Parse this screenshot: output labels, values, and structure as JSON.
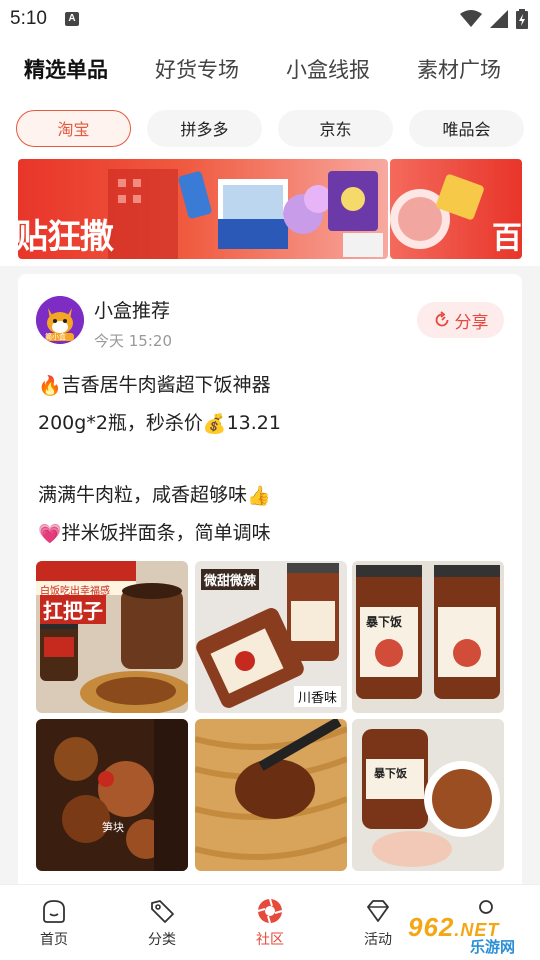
{
  "status_bar": {
    "time": "5:10",
    "notification_icon": "A"
  },
  "tabs": [
    {
      "label": "精选单品",
      "active": true
    },
    {
      "label": "好货专场",
      "active": false
    },
    {
      "label": "小盒线报",
      "active": false
    },
    {
      "label": "素材广场",
      "active": false
    }
  ],
  "platform_chips": [
    {
      "label": "淘宝",
      "active": true
    },
    {
      "label": "拼多多",
      "active": false
    },
    {
      "label": "京东",
      "active": false
    },
    {
      "label": "唯品会",
      "active": false
    }
  ],
  "banners": {
    "main_text": "贴狂撒",
    "side_text": "百"
  },
  "post": {
    "author": "小盒推荐",
    "time": "今天 15:20",
    "share_label": "分享",
    "avatar_label": "简小盒",
    "lines": [
      {
        "emoji": "🔥",
        "text": "吉香居牛肉酱超下饭神器"
      },
      {
        "text": "200g*2瓶，秒杀价",
        "emoji_after": "💰",
        "text_after": "13.21"
      },
      {
        "blank": true
      },
      {
        "text": "满满牛肉粒，咸香超够味",
        "emoji_after": "👍"
      },
      {
        "emoji": "💗",
        "text": "拌米饭拌面条，简单调味"
      }
    ],
    "images": [
      {
        "caption": "扛把子",
        "banner": "白饭吃出幸福感"
      },
      {
        "caption": "川香味",
        "banner": "微甜微辣"
      },
      {
        "caption": "暴下饭"
      },
      {
        "caption": "笋块"
      },
      {
        "caption": ""
      },
      {
        "caption": "暴下饭"
      }
    ]
  },
  "bottom_nav": [
    {
      "label": "首页",
      "icon": "home-icon",
      "active": false
    },
    {
      "label": "分类",
      "icon": "tag-icon",
      "active": false
    },
    {
      "label": "社区",
      "icon": "camera-shutter-icon",
      "active": true
    },
    {
      "label": "活动",
      "icon": "diamond-icon",
      "active": false
    },
    {
      "label": "",
      "icon": "user-icon",
      "active": false
    }
  ],
  "watermark": {
    "number": "962",
    "suffix": ".NET",
    "site": "乐游网"
  },
  "colors": {
    "accent": "#e5593f",
    "active_nav": "#e54a3b",
    "share_bg": "#fdeceb"
  }
}
